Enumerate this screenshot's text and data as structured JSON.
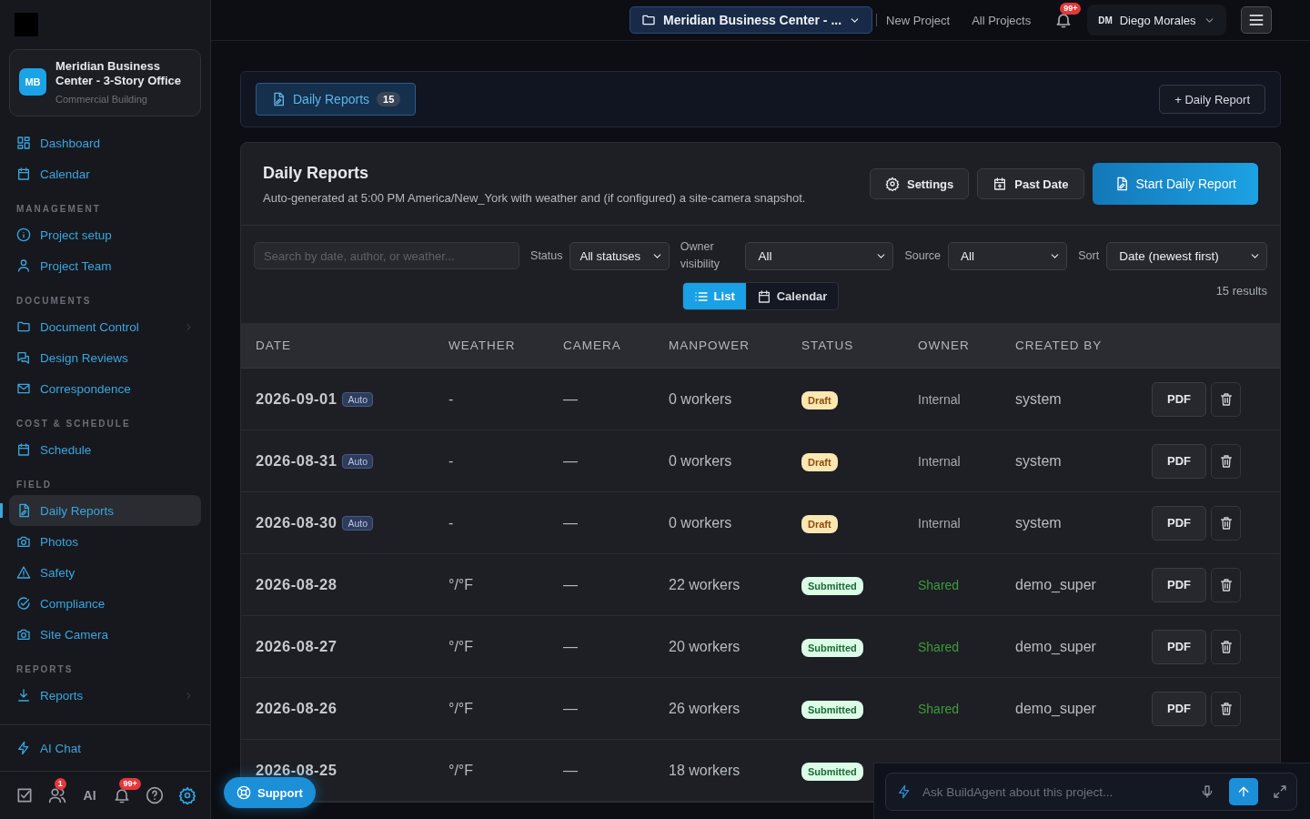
{
  "sidebar": {
    "project": {
      "initials": "MB",
      "name": "Meridian Business Center - 3-Story Office",
      "type": "Commercial Building"
    },
    "sections": [
      {
        "items": [
          {
            "label": "Dashboard",
            "selected": false,
            "expandable": false
          },
          {
            "label": "Calendar",
            "selected": false,
            "expandable": false
          }
        ]
      },
      {
        "title": "MANAGEMENT",
        "items": [
          {
            "label": "Project setup",
            "selected": false,
            "expandable": false
          },
          {
            "label": "Project Team",
            "selected": false,
            "expandable": false
          }
        ]
      },
      {
        "title": "DOCUMENTS",
        "items": [
          {
            "label": "Document Control",
            "selected": false,
            "expandable": true
          },
          {
            "label": "Design Reviews",
            "selected": false,
            "expandable": false
          },
          {
            "label": "Correspondence",
            "selected": false,
            "expandable": false
          }
        ]
      },
      {
        "title": "COST & SCHEDULE",
        "items": [
          {
            "label": "Schedule",
            "selected": false,
            "expandable": false
          }
        ]
      },
      {
        "title": "FIELD",
        "items": [
          {
            "label": "Daily Reports",
            "selected": true,
            "expandable": false
          },
          {
            "label": "Photos",
            "selected": false,
            "expandable": false
          },
          {
            "label": "Safety",
            "selected": false,
            "expandable": false
          },
          {
            "label": "Compliance",
            "selected": false,
            "expandable": false
          },
          {
            "label": "Site Camera",
            "selected": false,
            "expandable": false
          }
        ]
      },
      {
        "title": "REPORTS",
        "items": [
          {
            "label": "Reports",
            "selected": false,
            "expandable": true
          }
        ]
      }
    ],
    "ai_chat": "AI Chat",
    "footer_tools": [
      {
        "kind": "tasks",
        "selected": false
      },
      {
        "kind": "people",
        "badge": "1",
        "selected": false
      },
      {
        "kind": "ai",
        "label": "AI",
        "selected": false
      },
      {
        "kind": "alerts",
        "badge": "99+",
        "selected": false
      },
      {
        "kind": "help",
        "selected": false
      },
      {
        "kind": "settings",
        "selected": true
      }
    ]
  },
  "topbar": {
    "project_selector": "Meridian Business Center - ...",
    "links": [
      "New Project",
      "All Projects"
    ],
    "notifications_badge": "99+",
    "user": {
      "initials": "DM",
      "name": "Diego Morales"
    }
  },
  "page_header": {
    "tab": {
      "label": "Daily Reports",
      "count": "15",
      "selected": true
    },
    "add_button": "+ Daily Report"
  },
  "panel": {
    "title": "Daily Reports",
    "subtitle": "Auto-generated at 5:00 PM America/New_York with weather and (if configured) a site-camera snapshot.",
    "buttons": [
      {
        "label": "Settings",
        "kind": "settings"
      },
      {
        "label": "Past Date",
        "kind": "past"
      },
      {
        "label": "Start Daily Report",
        "kind": "primary"
      }
    ],
    "search": {
      "placeholder": "Search by date, author, or weather..."
    },
    "filters": [
      {
        "label": "Status",
        "value": "All statuses"
      },
      {
        "label": "Owner visibility",
        "value": "All"
      },
      {
        "label": "Source",
        "value": "All"
      },
      {
        "label": "Sort",
        "value": "Date (newest first)"
      }
    ],
    "views": [
      {
        "label": "List",
        "selected": true
      },
      {
        "label": "Calendar",
        "selected": false
      }
    ],
    "results": "15 results"
  },
  "table": {
    "columns": [
      "DATE",
      "WEATHER",
      "CAMERA",
      "MANPOWER",
      "STATUS",
      "OWNER",
      "CREATED BY"
    ],
    "rows": [
      {
        "date": "2026-09-01",
        "auto": "Auto",
        "weather": "-",
        "camera": "—",
        "manpower": "0 workers",
        "status": {
          "label": "Draft",
          "kind": "draft"
        },
        "owner": {
          "label": "Internal",
          "kind": "internal"
        },
        "created_by": "system",
        "pdf": "PDF"
      },
      {
        "date": "2026-08-31",
        "auto": "Auto",
        "weather": "-",
        "camera": "—",
        "manpower": "0 workers",
        "status": {
          "label": "Draft",
          "kind": "draft"
        },
        "owner": {
          "label": "Internal",
          "kind": "internal"
        },
        "created_by": "system",
        "pdf": "PDF"
      },
      {
        "date": "2026-08-30",
        "auto": "Auto",
        "weather": "-",
        "camera": "—",
        "manpower": "0 workers",
        "status": {
          "label": "Draft",
          "kind": "draft"
        },
        "owner": {
          "label": "Internal",
          "kind": "internal"
        },
        "created_by": "system",
        "pdf": "PDF"
      },
      {
        "date": "2026-08-28",
        "weather": "°/°F",
        "camera": "—",
        "manpower": "22 workers",
        "status": {
          "label": "Submitted",
          "kind": "submitted"
        },
        "owner": {
          "label": "Shared",
          "kind": "shared"
        },
        "created_by": "demo_super",
        "pdf": "PDF"
      },
      {
        "date": "2026-08-27",
        "weather": "°/°F",
        "camera": "—",
        "manpower": "20 workers",
        "status": {
          "label": "Submitted",
          "kind": "submitted"
        },
        "owner": {
          "label": "Shared",
          "kind": "shared"
        },
        "created_by": "demo_super",
        "pdf": "PDF"
      },
      {
        "date": "2026-08-26",
        "weather": "°/°F",
        "camera": "—",
        "manpower": "26 workers",
        "status": {
          "label": "Submitted",
          "kind": "submitted"
        },
        "owner": {
          "label": "Shared",
          "kind": "shared"
        },
        "created_by": "demo_super",
        "pdf": "PDF"
      },
      {
        "date": "2026-08-25",
        "weather": "°/°F",
        "camera": "—",
        "manpower": "18 workers",
        "status": {
          "label": "Submitted",
          "kind": "submitted"
        }
      }
    ]
  },
  "support_button": "Support",
  "chat": {
    "placeholder": "Ask BuildAgent about this project..."
  }
}
